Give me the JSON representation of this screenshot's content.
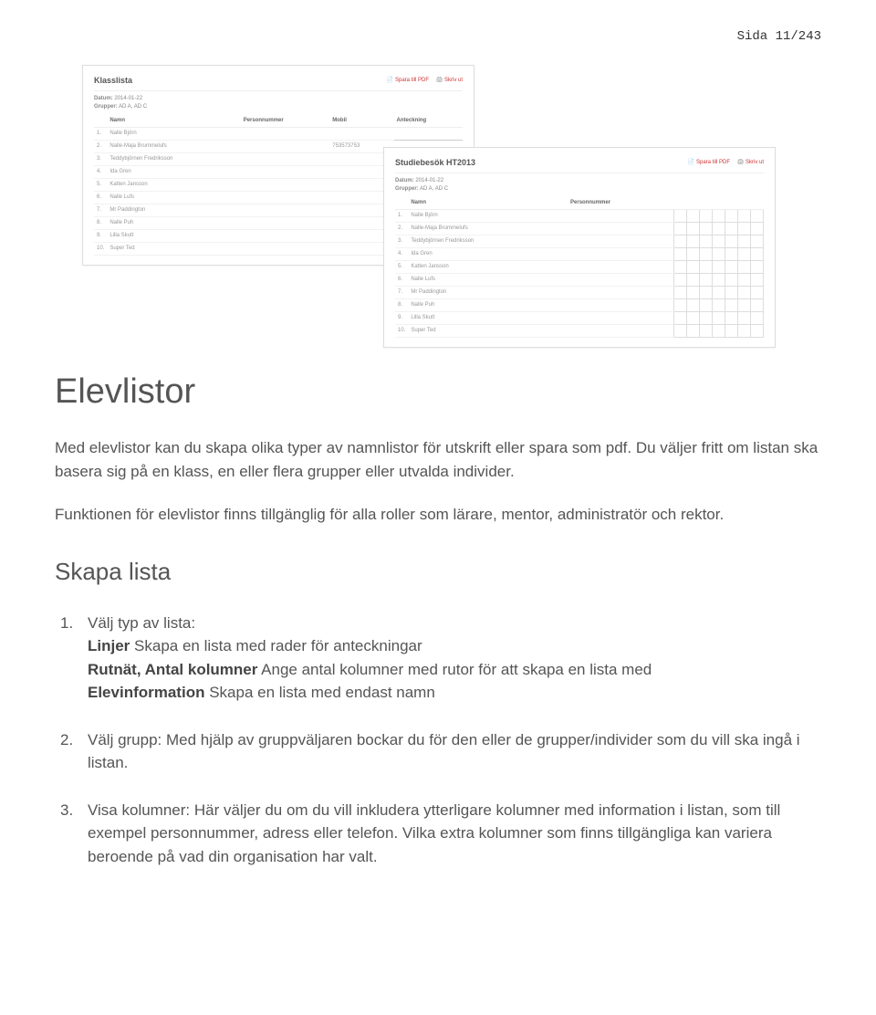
{
  "page_number": "Sida 11/243",
  "thumbA": {
    "title": "Klasslista",
    "datum_label": "Datum:",
    "datum": "2014-01-22",
    "grupper_label": "Grupper:",
    "grupper": "AD A, AD C",
    "action_pdf": "Spara till PDF",
    "action_print": "Skriv ut",
    "cols": {
      "namn": "Namn",
      "pnr": "Personnummer",
      "mobil": "Mobil",
      "ant": "Anteckning"
    },
    "rows": [
      {
        "n": "1.",
        "namn": "Nalle Björn",
        "mobil": ""
      },
      {
        "n": "2.",
        "namn": "Nalle-Maja Brummelufs",
        "mobil": "753573753"
      },
      {
        "n": "3.",
        "namn": "Teddybjörnen Fredriksson",
        "mobil": ""
      },
      {
        "n": "4.",
        "namn": "Ida Gren",
        "mobil": ""
      },
      {
        "n": "5.",
        "namn": "Katten Jansson",
        "mobil": ""
      },
      {
        "n": "6.",
        "namn": "Nalle Lufs",
        "mobil": ""
      },
      {
        "n": "7.",
        "namn": "Mr Paddington",
        "mobil": ""
      },
      {
        "n": "8.",
        "namn": "Nalle Puh",
        "mobil": ""
      },
      {
        "n": "9.",
        "namn": "Lilla Skutt",
        "mobil": ""
      },
      {
        "n": "10.",
        "namn": "Super Ted",
        "mobil": ""
      }
    ]
  },
  "thumbB": {
    "title": "Studiebesök HT2013",
    "datum_label": "Datum:",
    "datum": "2014-01-22",
    "grupper_label": "Grupper:",
    "grupper": "AD A, AD C",
    "action_pdf": "Spara till PDF",
    "action_print": "Skriv ut",
    "cols": {
      "namn": "Namn",
      "pnr": "Personnummer"
    },
    "rows": [
      {
        "n": "1.",
        "namn": "Nalle Björn"
      },
      {
        "n": "2.",
        "namn": "Nalle-Maja Brummelufs"
      },
      {
        "n": "3.",
        "namn": "Teddybjörnen Fredriksson"
      },
      {
        "n": "4.",
        "namn": "Ida Gren"
      },
      {
        "n": "5.",
        "namn": "Katten Jansson"
      },
      {
        "n": "6.",
        "namn": "Nalle Lufs"
      },
      {
        "n": "7.",
        "namn": "Mr Paddington"
      },
      {
        "n": "8.",
        "namn": "Nalle Puh"
      },
      {
        "n": "9.",
        "namn": "Lilla Skutt"
      },
      {
        "n": "10.",
        "namn": "Super Ted"
      }
    ]
  },
  "heading": "Elevlistor",
  "para1": "Med elevlistor kan du skapa olika typer av namnlistor för utskrift eller spara som pdf. Du väljer fritt om listan ska basera sig på en klass, en eller flera grupper eller utvalda individer.",
  "para2": "Funktionen för elevlistor finns tillgänglig för alla roller som lärare, mentor, administratör och rektor.",
  "subheading": "Skapa lista",
  "step1": {
    "lead": "Välj typ av lista:",
    "linjer_label": "Linjer",
    "linjer_text": " Skapa en lista med rader för anteckningar",
    "rutnat_label": "Rutnät, Antal kolumner",
    "rutnat_text": " Ange antal kolumner med rutor för att skapa en lista med",
    "elev_label": "Elevinformation",
    "elev_text": " Skapa en lista med endast namn"
  },
  "step2": "Välj grupp: Med hjälp av gruppväljaren bockar du för den eller de grupper/individer som du vill ska ingå i listan.",
  "step3": "Visa kolumner: Här väljer du om du vill inkludera ytterligare kolumner med information i listan, som till exempel personnummer, adress eller telefon. Vilka extra kolumner som finns tillgängliga kan variera beroende på vad din organisation har valt."
}
